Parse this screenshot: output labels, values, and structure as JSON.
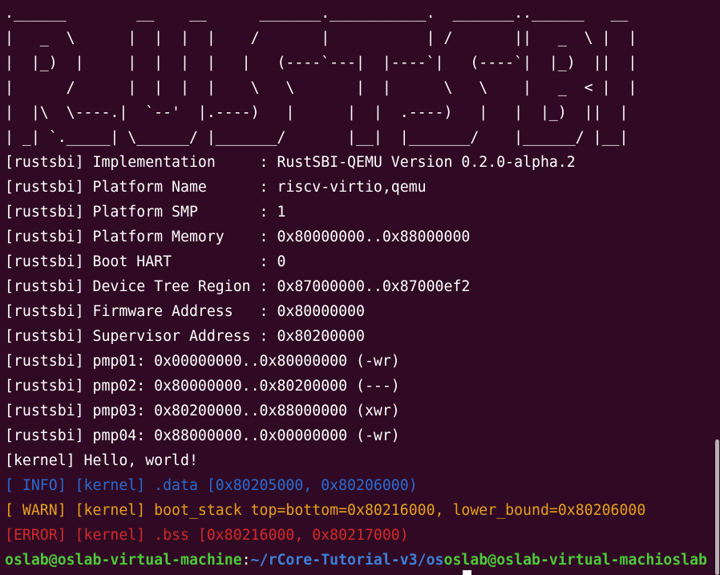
{
  "logo": ".______        __    __      _______.___________.  _______..______   __\n|   _  \\      |  |  |  |    /       |           | /       ||   _  \\ |  |\n|  |_)  |     |  |  |  |   |   (----`---|  |----`|   (----`|  |_)  ||  |\n|      /      |  |  |  |    \\   \\       |  |      \\   \\    |   _  < |  |\n|  |\\  \\----.|  `--'  |.----)   |      |  |  .----)   |   |  |_)  ||  |\n| _| `._____| \\______/ |_______/       |__|  |_______/    |______/ |__|",
  "lines": [
    "[rustsbi] Implementation     : RustSBI-QEMU Version 0.2.0-alpha.2",
    "[rustsbi] Platform Name      : riscv-virtio,qemu",
    "[rustsbi] Platform SMP       : 1",
    "[rustsbi] Platform Memory    : 0x80000000..0x88000000",
    "[rustsbi] Boot HART          : 0",
    "[rustsbi] Device Tree Region : 0x87000000..0x87000ef2",
    "[rustsbi] Firmware Address   : 0x80000000",
    "[rustsbi] Supervisor Address : 0x80200000",
    "[rustsbi] pmp01: 0x00000000..0x80000000 (-wr)",
    "[rustsbi] pmp02: 0x80000000..0x80200000 (---)",
    "[rustsbi] pmp03: 0x80200000..0x88000000 (xwr)",
    "[rustsbi] pmp04: 0x88000000..0x00000000 (-wr)",
    "[kernel] Hello, world!"
  ],
  "log": {
    "info": "[ INFO] [kernel] .data [0x80205000, 0x80206000)",
    "warn": "[ WARN] [kernel] boot_stack top=bottom=0x80216000, lower_bound=0x80206000",
    "error": "[ERROR] [kernel] .bss [0x80216000, 0x80217000)"
  },
  "prompt": {
    "user_host": "oslab@oslab-virtual-machine",
    "sep": ":",
    "path": "~/rCore-Tutorial-v3/os",
    "trailing": "oslab@oslab-virtual-machioslab"
  },
  "colors": {
    "background": "#300a24",
    "info": "#2a6bd2",
    "warn": "#e6a01c",
    "error": "#d42a2a",
    "prompt_user": "#4ec93a",
    "prompt_path": "#3f7fd9"
  }
}
